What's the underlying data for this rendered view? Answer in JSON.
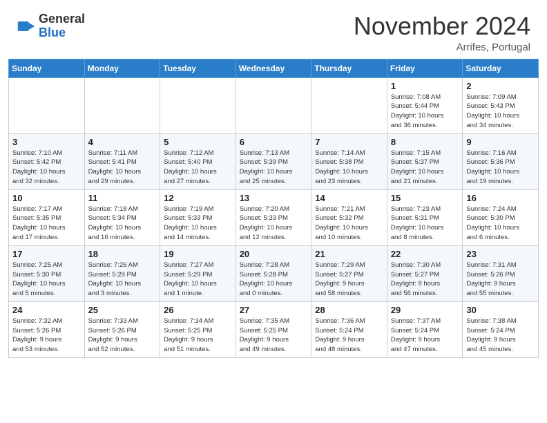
{
  "header": {
    "logo_general": "General",
    "logo_blue": "Blue",
    "month_title": "November 2024",
    "location": "Arrifes, Portugal"
  },
  "weekdays": [
    "Sunday",
    "Monday",
    "Tuesday",
    "Wednesday",
    "Thursday",
    "Friday",
    "Saturday"
  ],
  "weeks": [
    [
      {
        "day": "",
        "info": ""
      },
      {
        "day": "",
        "info": ""
      },
      {
        "day": "",
        "info": ""
      },
      {
        "day": "",
        "info": ""
      },
      {
        "day": "",
        "info": ""
      },
      {
        "day": "1",
        "info": "Sunrise: 7:08 AM\nSunset: 5:44 PM\nDaylight: 10 hours\nand 36 minutes."
      },
      {
        "day": "2",
        "info": "Sunrise: 7:09 AM\nSunset: 5:43 PM\nDaylight: 10 hours\nand 34 minutes."
      }
    ],
    [
      {
        "day": "3",
        "info": "Sunrise: 7:10 AM\nSunset: 5:42 PM\nDaylight: 10 hours\nand 32 minutes."
      },
      {
        "day": "4",
        "info": "Sunrise: 7:11 AM\nSunset: 5:41 PM\nDaylight: 10 hours\nand 29 minutes."
      },
      {
        "day": "5",
        "info": "Sunrise: 7:12 AM\nSunset: 5:40 PM\nDaylight: 10 hours\nand 27 minutes."
      },
      {
        "day": "6",
        "info": "Sunrise: 7:13 AM\nSunset: 5:39 PM\nDaylight: 10 hours\nand 25 minutes."
      },
      {
        "day": "7",
        "info": "Sunrise: 7:14 AM\nSunset: 5:38 PM\nDaylight: 10 hours\nand 23 minutes."
      },
      {
        "day": "8",
        "info": "Sunrise: 7:15 AM\nSunset: 5:37 PM\nDaylight: 10 hours\nand 21 minutes."
      },
      {
        "day": "9",
        "info": "Sunrise: 7:16 AM\nSunset: 5:36 PM\nDaylight: 10 hours\nand 19 minutes."
      }
    ],
    [
      {
        "day": "10",
        "info": "Sunrise: 7:17 AM\nSunset: 5:35 PM\nDaylight: 10 hours\nand 17 minutes."
      },
      {
        "day": "11",
        "info": "Sunrise: 7:18 AM\nSunset: 5:34 PM\nDaylight: 10 hours\nand 16 minutes."
      },
      {
        "day": "12",
        "info": "Sunrise: 7:19 AM\nSunset: 5:33 PM\nDaylight: 10 hours\nand 14 minutes."
      },
      {
        "day": "13",
        "info": "Sunrise: 7:20 AM\nSunset: 5:33 PM\nDaylight: 10 hours\nand 12 minutes."
      },
      {
        "day": "14",
        "info": "Sunrise: 7:21 AM\nSunset: 5:32 PM\nDaylight: 10 hours\nand 10 minutes."
      },
      {
        "day": "15",
        "info": "Sunrise: 7:23 AM\nSunset: 5:31 PM\nDaylight: 10 hours\nand 8 minutes."
      },
      {
        "day": "16",
        "info": "Sunrise: 7:24 AM\nSunset: 5:30 PM\nDaylight: 10 hours\nand 6 minutes."
      }
    ],
    [
      {
        "day": "17",
        "info": "Sunrise: 7:25 AM\nSunset: 5:30 PM\nDaylight: 10 hours\nand 5 minutes."
      },
      {
        "day": "18",
        "info": "Sunrise: 7:26 AM\nSunset: 5:29 PM\nDaylight: 10 hours\nand 3 minutes."
      },
      {
        "day": "19",
        "info": "Sunrise: 7:27 AM\nSunset: 5:29 PM\nDaylight: 10 hours\nand 1 minute."
      },
      {
        "day": "20",
        "info": "Sunrise: 7:28 AM\nSunset: 5:28 PM\nDaylight: 10 hours\nand 0 minutes."
      },
      {
        "day": "21",
        "info": "Sunrise: 7:29 AM\nSunset: 5:27 PM\nDaylight: 9 hours\nand 58 minutes."
      },
      {
        "day": "22",
        "info": "Sunrise: 7:30 AM\nSunset: 5:27 PM\nDaylight: 9 hours\nand 56 minutes."
      },
      {
        "day": "23",
        "info": "Sunrise: 7:31 AM\nSunset: 5:26 PM\nDaylight: 9 hours\nand 55 minutes."
      }
    ],
    [
      {
        "day": "24",
        "info": "Sunrise: 7:32 AM\nSunset: 5:26 PM\nDaylight: 9 hours\nand 53 minutes."
      },
      {
        "day": "25",
        "info": "Sunrise: 7:33 AM\nSunset: 5:26 PM\nDaylight: 9 hours\nand 52 minutes."
      },
      {
        "day": "26",
        "info": "Sunrise: 7:34 AM\nSunset: 5:25 PM\nDaylight: 9 hours\nand 51 minutes."
      },
      {
        "day": "27",
        "info": "Sunrise: 7:35 AM\nSunset: 5:25 PM\nDaylight: 9 hours\nand 49 minutes."
      },
      {
        "day": "28",
        "info": "Sunrise: 7:36 AM\nSunset: 5:24 PM\nDaylight: 9 hours\nand 48 minutes."
      },
      {
        "day": "29",
        "info": "Sunrise: 7:37 AM\nSunset: 5:24 PM\nDaylight: 9 hours\nand 47 minutes."
      },
      {
        "day": "30",
        "info": "Sunrise: 7:38 AM\nSunset: 5:24 PM\nDaylight: 9 hours\nand 45 minutes."
      }
    ]
  ]
}
